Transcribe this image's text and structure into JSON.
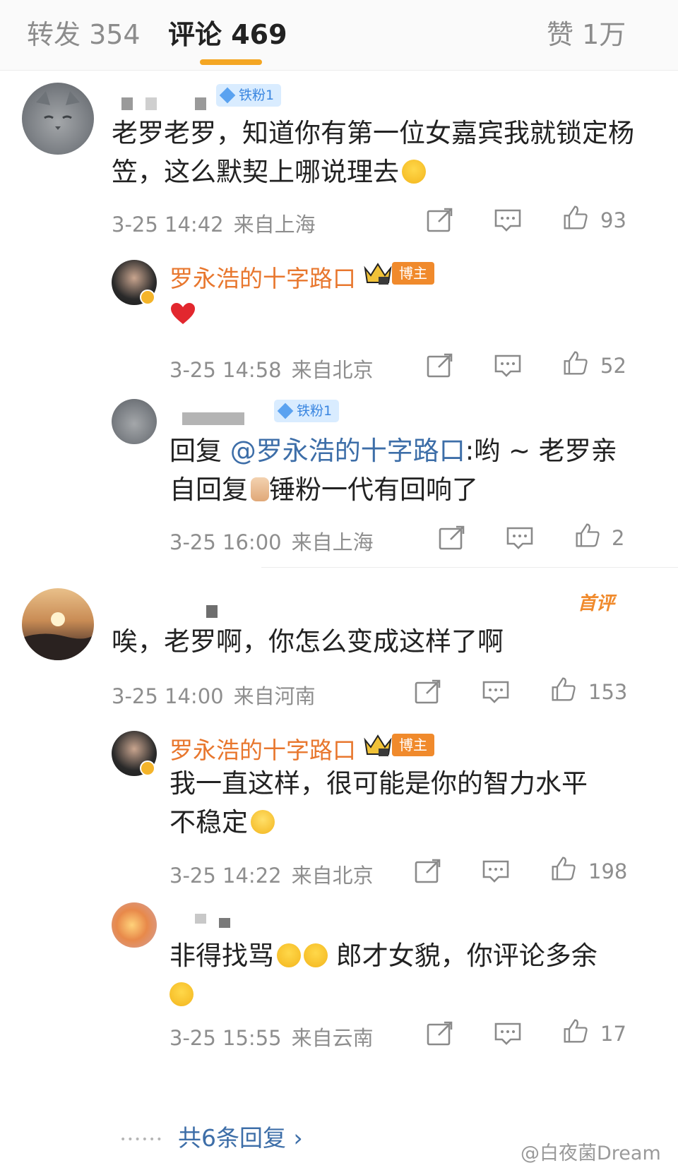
{
  "tabs": [
    {
      "label": "转发 354"
    },
    {
      "label": "评论 469"
    },
    {
      "label": "赞 1万"
    }
  ],
  "comments": [
    {
      "badge": "铁粉1",
      "text": "老罗老罗，知道你有第一位女嘉宾我就锁定杨笠，这么默契上哪说理去",
      "time": "3-25 14:42",
      "location": "来自上海",
      "likes": "93"
    },
    {
      "name": "罗永浩的十字路口",
      "badge": "博主",
      "time": "3-25 14:58",
      "location": "来自北京",
      "likes": "52"
    },
    {
      "badge": "铁粉1",
      "reply_prefix": "回复",
      "mention": "@罗永浩的十字路口",
      "text_a": ":哟 ~ 老罗亲",
      "text_b": "自回复",
      "text_c": "锤粉一代有回响了",
      "time": "3-25 16:00",
      "location": "来自上海",
      "likes": "2"
    },
    {
      "tag": "首评",
      "text": "唉，老罗啊，你怎么变成这样了啊",
      "time": "3-25 14:00",
      "location": "来自河南",
      "likes": "153"
    },
    {
      "name": "罗永浩的十字路口",
      "badge": "博主",
      "text_a": "我一直这样，很可能是你的智力水平",
      "text_b": "不稳定",
      "time": "3-25 14:22",
      "location": "来自北京",
      "likes": "198"
    },
    {
      "text_a": "非得找骂",
      "text_b": "郎才女貌，你评论多余",
      "time": "3-25 15:55",
      "location": "来自云南",
      "likes": "17"
    }
  ],
  "more_replies": "共6条回复 ›",
  "watermark": "@白夜菌Dream",
  "colors": {
    "accent": "#f4a623",
    "blogger_name": "#e8772e",
    "mention": "#3d6ea8",
    "meta": "#8e8e8e"
  }
}
